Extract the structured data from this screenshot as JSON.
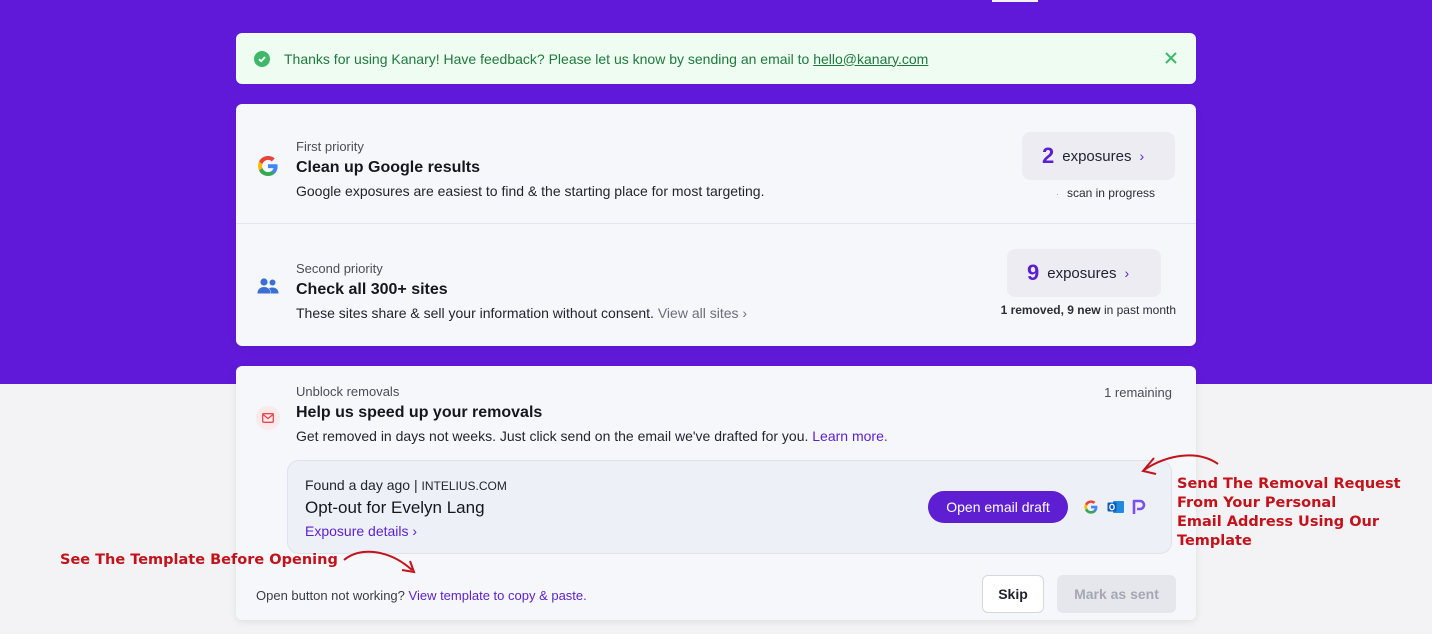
{
  "banner": {
    "message": "Thanks for using Kanary! Have feedback? Please let us know by sending an email to",
    "email": "hello@kanary.com",
    "close_icon": "close-icon"
  },
  "priorities": [
    {
      "label": "First priority",
      "title": "Clean up Google results",
      "description": "Google exposures are easiest to find & the starting place for most targeting.",
      "count": "2",
      "count_label": "exposures",
      "status": "scan in progress",
      "icon": "google-icon"
    },
    {
      "label": "Second priority",
      "title": "Check all 300+ sites",
      "description": "These sites share & sell your information without consent.",
      "link": "View all sites",
      "count": "9",
      "count_label": "exposures",
      "status_bold": "1 removed, 9 new",
      "status_rest": "in past month",
      "icon": "people-icon"
    }
  ],
  "unblock": {
    "label": "Unblock removals",
    "remaining": "1 remaining",
    "title": "Help us speed up your removals",
    "description": "Get removed in days not weeks. Just click send on the email we've drafted for you.",
    "learn_more": "Learn more.",
    "item": {
      "found": "Found a day ago |",
      "site": "INTELIUS.COM",
      "name": "Opt-out for Evelyn Lang",
      "details_link": "Exposure details",
      "open_button": "Open email draft",
      "providers": [
        "google-icon",
        "outlook-icon",
        "proton-icon"
      ]
    },
    "footer": {
      "text": "Open button not working?",
      "link": "View template to copy & paste.",
      "skip": "Skip",
      "mark_sent": "Mark as sent"
    }
  },
  "annotations": {
    "left": "See The Template Before Opening",
    "right_lines": [
      "Send The Removal Request",
      "From Your Personal",
      "Email Address Using Our",
      "Template"
    ]
  },
  "colors": {
    "brand": "#6119d9",
    "accent": "#5a1fd1",
    "success": "#3fb86a",
    "annotation": "#c4121a"
  }
}
